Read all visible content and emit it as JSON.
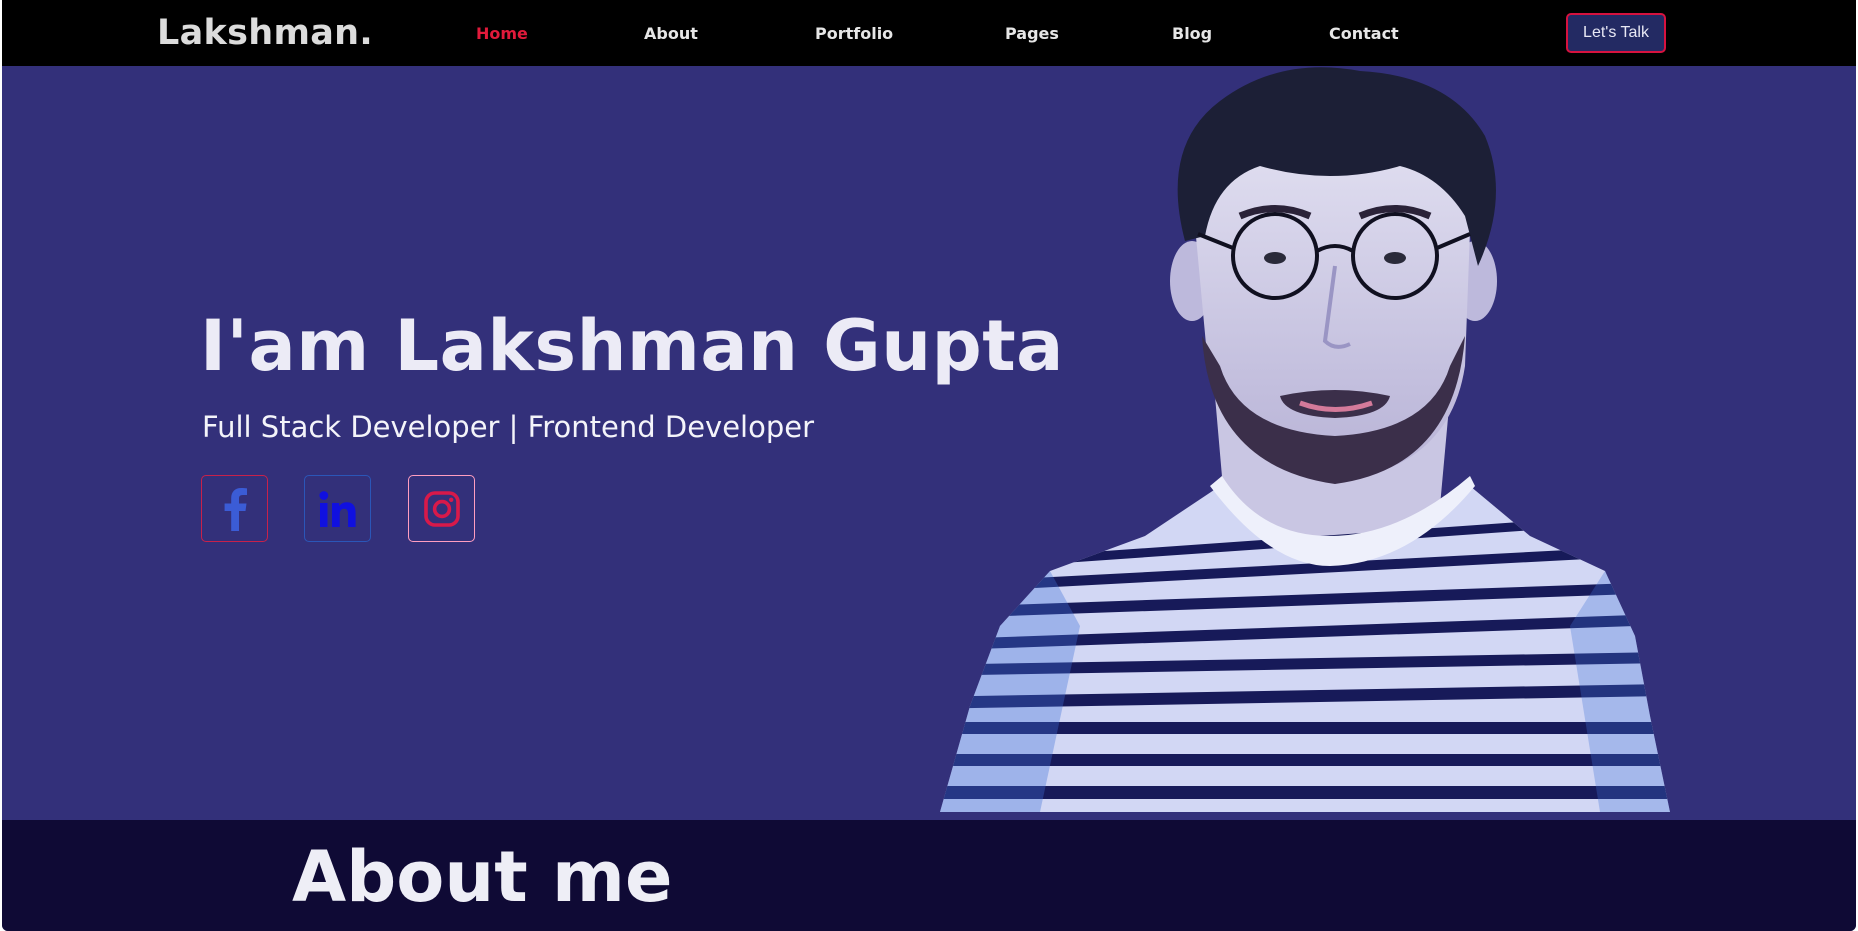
{
  "navbar": {
    "brand": "Lakshman.",
    "links": [
      {
        "label": "Home",
        "active": true
      },
      {
        "label": "About",
        "active": false
      },
      {
        "label": "Portfolio",
        "active": false
      },
      {
        "label": "Pages",
        "active": false
      },
      {
        "label": "Blog",
        "active": false
      },
      {
        "label": "Contact",
        "active": false
      }
    ],
    "cta_label": "Let's Talk"
  },
  "hero": {
    "title": "I'am Lakshman Gupta",
    "subtitle": "Full Stack Developer | Frontend Developer",
    "social": [
      {
        "icon": "facebook-icon",
        "color": "#3b5cd6"
      },
      {
        "icon": "linkedin-icon",
        "color": "#1010e0"
      },
      {
        "icon": "instagram-icon",
        "color": "#d8194a"
      }
    ]
  },
  "about": {
    "title": "About me"
  },
  "colors": {
    "navbar_bg": "#000000",
    "hero_bg": "#33307a",
    "about_bg": "#0f0a35",
    "accent": "#e11a3b",
    "button_bg": "#232a63"
  }
}
